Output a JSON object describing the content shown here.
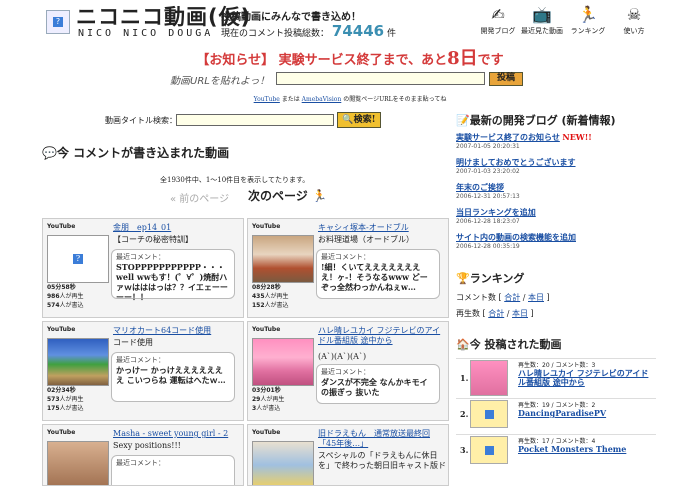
{
  "header": {
    "logo_text": "ニコニコ動画(仮)",
    "logo_sub": "NICO NICO DOUGA",
    "tagline": "投稿動画にみんなで書き込め！",
    "count_prefix": "現在のコメント投稿総数：",
    "count_value": "74446",
    "count_suffix": "件",
    "icons": [
      {
        "label": "開発ブログ",
        "icon": "blog-icon"
      },
      {
        "label": "最近見た動画",
        "icon": "recent-videos-icon"
      },
      {
        "label": "ランキング",
        "icon": "ranking-icon"
      },
      {
        "label": "使い方",
        "icon": "help-icon"
      }
    ]
  },
  "notice": {
    "prefix": "【お知らせ】 実験サービス終了まで、あと",
    "days": "8日",
    "suffix": "です"
  },
  "url_form": {
    "label": "動画URLを貼れよっ！",
    "button": "投稿",
    "hint_link1": "YouTube",
    "hint_mid": " または ",
    "hint_link2": "AmebaVision",
    "hint_tail": " の閲覧ページURLをそのまま貼ってね"
  },
  "search": {
    "label": "動画タイトル検索：",
    "button": "検索!"
  },
  "main": {
    "heading": "今 コメントが書き込まれた動画",
    "pager_info": "全1930件中、1〜10件目を表示してたります。",
    "prev": "前のページ",
    "next": "次のページ",
    "cards": [
      {
        "source": "YouTube",
        "title": "金朋　ep14_01",
        "desc": "【コーチの秘密特訓】",
        "comment_label": "最近コメント：",
        "comment": "STOPPPPPPPPPPP・・・well wwもす！(゜∀゜)焼酎ハァｗはははっは？？イエェーーーー！！",
        "duration": "05分58秒",
        "views": "986",
        "comments": "574"
      },
      {
        "source": "YouTube",
        "title": "キャシィ塚本-オードブル",
        "desc": "お料理道場（オードブル）",
        "comment_label": "最近コメント：",
        "comment": "!細！くいてええええええええ！ヶ-！そうなるwww どーぞっ全然わっかんねぇw…",
        "duration": "08分28秒",
        "views": "435",
        "comments": "152"
      },
      {
        "source": "YouTube",
        "title": "マリオカート64コード使用",
        "desc": "コード使用",
        "comment_label": "最近コメント：",
        "comment": "かっけー かっけえええええええ こいつらね 運転はへたｗ…",
        "duration": "02分34秒",
        "views": "573",
        "comments": "175"
      },
      {
        "source": "YouTube",
        "title": "ハレ晴レユカイ フジテレビのアイドル番組版 途中から",
        "desc": "(A`)(A`)(A`)",
        "comment_label": "最近コメント：",
        "comment": "ダンスが不完全 なんかキモイの振ぎっ 抜いた",
        "duration": "03分01秒",
        "views": "29",
        "comments": "3"
      },
      {
        "source": "YouTube",
        "title": "Masha - sweet young girl - 2",
        "desc": "Sexy positions!!!",
        "comment_label": "最近コメント：",
        "comment": "",
        "duration": "",
        "views": "",
        "comments": ""
      },
      {
        "source": "YouTube",
        "title": "旧ドラえもん　通常放送最終回「45年後…」",
        "desc": "スペシャルの「ドラえもんに休日を」で終わった朝日旧キャスト版ド",
        "comment_label": "",
        "comment": "",
        "duration": "",
        "views": "",
        "comments": ""
      }
    ],
    "meta_views_suffix": "人が再生",
    "meta_comments_suffix": "人が書込"
  },
  "blog": {
    "heading": "最新の開発ブログ (新着情報)",
    "entries": [
      {
        "title": "実験サービス終了のお知らせ",
        "new": "NEW!!",
        "date": "2007-01-05 20:20:31"
      },
      {
        "title": "明けましておめでとうございます",
        "new": "",
        "date": "2007-01-03 23:20:02"
      },
      {
        "title": "年末のご挨拶",
        "new": "",
        "date": "2006-12-31 20:57:13"
      },
      {
        "title": "当日ランキングを追加",
        "new": "",
        "date": "2006-12-28 18:23:07"
      },
      {
        "title": "サイト内の動画の検索機能を追加",
        "new": "",
        "date": "2006-12-28 00:35:19"
      }
    ]
  },
  "ranking": {
    "heading": "ランキング",
    "rows": [
      {
        "label": "コメント数",
        "links": [
          "合計",
          "本日"
        ]
      },
      {
        "label": "再生数",
        "links": [
          "合計",
          "本日"
        ]
      }
    ]
  },
  "posted": {
    "heading": "今 投稿された動画",
    "items": [
      {
        "num": "1.",
        "meta": "再生数：20 / コメント数：3",
        "title": "ハレ晴レユカイ フジテレビのアイドル番組版 途中から"
      },
      {
        "num": "2.",
        "meta": "再生数：19 / コメント数：2",
        "title": "DancingParadisePV"
      },
      {
        "num": "3.",
        "meta": "再生数：17 / コメント数：4",
        "title": "Pocket Monsters Theme"
      }
    ]
  }
}
